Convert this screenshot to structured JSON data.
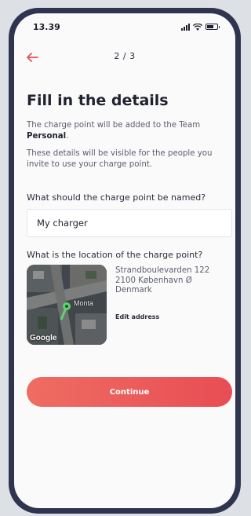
{
  "status_bar": {
    "time": "13.39",
    "icons": [
      "signal-icon",
      "wifi-icon",
      "battery-icon"
    ]
  },
  "nav": {
    "back_icon": "arrow-left-icon",
    "step": "2 / 3"
  },
  "title": "Fill in the details",
  "description": {
    "team_text": "The charge point will be added to the Team",
    "team_name": "Personal",
    "visibility": "These details will be visible for the people you invite to use your charge point."
  },
  "name_field": {
    "label": "What should the charge point be named?",
    "value": "My charger"
  },
  "location": {
    "label": "What is the location of the charge point?",
    "map_pin_label": "Monta",
    "map_attribution": "Google",
    "address_line1": "Strandboulevarden 122",
    "address_line2": "2100  København Ø",
    "address_line3": "Denmark",
    "edit_label": "Edit address"
  },
  "continue_label": "Continue",
  "colors": {
    "accent": "#e8515a",
    "frame": "#2f3450",
    "text_dark": "#20232f",
    "text_muted": "#5c606d"
  }
}
